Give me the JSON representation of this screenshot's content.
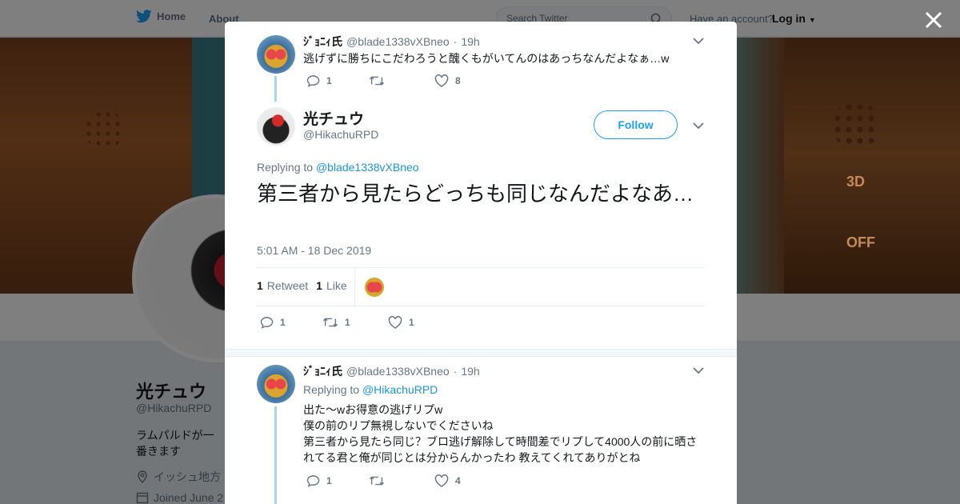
{
  "nav": {
    "home": "Home",
    "about": "About",
    "search_placeholder": "Search Twitter",
    "have_account": "Have an account?",
    "login": "Log in"
  },
  "banner": {
    "label_3d": "3D",
    "label_off": "OFF"
  },
  "profile": {
    "name": "光チュウ",
    "handle": "@HikachuRPD",
    "bio": "ラムパルドが一番きます",
    "location": "イッシュ地方",
    "joined": "Joined June 2"
  },
  "tweet_prev": {
    "name": "ｼﾞｮﾆｨ氏",
    "handle": "@blade1338vXBneo",
    "dot": "·",
    "time": "19h",
    "text": "逃げずに勝ちにこだわろうと醜くもがいてんのはあっちなんだよなぁ…w",
    "replies": "1",
    "retweets": "",
    "likes": "8"
  },
  "tweet_main": {
    "name": "光チュウ",
    "handle": "@HikachuRPD",
    "follow": "Follow",
    "replying_label": "Replying to",
    "replying_to": "@blade1338vXBneo",
    "text": "第三者から見たらどっちも同じなんだよなあ…",
    "timestamp": "5:01 AM - 18 Dec 2019",
    "retweet_count": "1",
    "retweet_label": "Retweet",
    "like_count": "1",
    "like_label": "Like",
    "replies": "1",
    "retweets": "1",
    "likes": "1"
  },
  "tweet_reply": {
    "name": "ｼﾞｮﾆｨ氏",
    "handle": "@blade1338vXBneo",
    "dot": "·",
    "time": "19h",
    "replying_label": "Replying to",
    "replying_to": "@HikachuRPD",
    "lines": [
      "出た〜wお得意の逃げリプw",
      "僕の前のリプ無視しないでくださいね",
      "第三者から見たら同じ？ブロ逃げ解除して時間差でリプして4000人の前に晒されてる君と俺が同じとは分からんかったわ 教えてくれてありがとね"
    ],
    "replies": "1",
    "retweets": "",
    "likes": "4"
  },
  "colors": {
    "accent": "#1da1f2",
    "link": "#1b95e0",
    "muted": "#657786",
    "thread": "#a8d4f2"
  },
  "icons": [
    "twitter-bird-icon",
    "search-icon",
    "caret-down-icon",
    "close-icon",
    "reply-icon",
    "retweet-icon",
    "like-icon",
    "chevron-down-icon",
    "location-icon",
    "calendar-icon"
  ]
}
